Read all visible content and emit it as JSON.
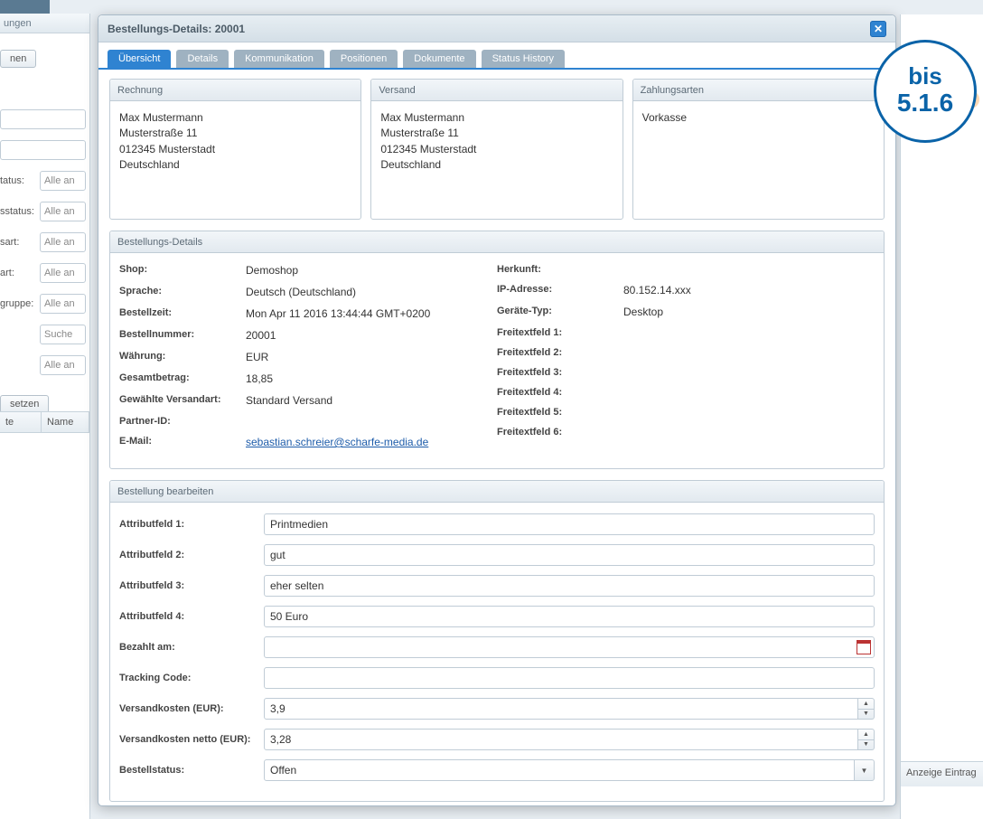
{
  "left": {
    "header": "ungen",
    "btn_nen": "nen",
    "filters": {
      "tatus": {
        "label": "tatus:",
        "value": "Alle an"
      },
      "sstatus": {
        "label": "sstatus:",
        "value": "Alle an"
      },
      "sart": {
        "label": "sart:",
        "value": "Alle an"
      },
      "art": {
        "label": "art:",
        "value": "Alle an"
      },
      "gruppe": {
        "label": "gruppe:",
        "value": "Alle an"
      },
      "suche": {
        "label": "",
        "value": "Suche"
      },
      "alle": {
        "label": "",
        "value": "Alle an"
      }
    },
    "btn_setzen": "setzen",
    "grid_h1": "te",
    "grid_h2": "Name"
  },
  "dialog": {
    "title": "Bestellungs-Details: 20001",
    "tabs": [
      "Übersicht",
      "Details",
      "Kommunikation",
      "Positionen",
      "Dokumente",
      "Status History"
    ],
    "panels": {
      "rechnung": {
        "h": "Rechnung",
        "name": "Max Mustermann",
        "street": "Musterstraße 11",
        "city": "012345 Musterstadt",
        "country": "Deutschland"
      },
      "versand": {
        "h": "Versand",
        "name": "Max Mustermann",
        "street": "Musterstraße 11",
        "city": "012345 Musterstadt",
        "country": "Deutschland"
      },
      "zahlung": {
        "h": "Zahlungsarten",
        "val": "Vorkasse"
      }
    },
    "details": {
      "h": "Bestellungs-Details",
      "left": {
        "shop": {
          "k": "Shop:",
          "v": "Demoshop"
        },
        "sprache": {
          "k": "Sprache:",
          "v": "Deutsch (Deutschland)"
        },
        "bestellzeit": {
          "k": "Bestellzeit:",
          "v": "Mon Apr 11 2016 13:44:44 GMT+0200"
        },
        "bestellnr": {
          "k": "Bestellnummer:",
          "v": "20001"
        },
        "waehrung": {
          "k": "Währung:",
          "v": "EUR"
        },
        "betrag": {
          "k": "Gesamtbetrag:",
          "v": "18,85"
        },
        "versandart": {
          "k": "Gewählte Versandart:",
          "v": "Standard Versand"
        },
        "partner": {
          "k": "Partner-ID:",
          "v": ""
        },
        "email": {
          "k": "E-Mail:",
          "v": "sebastian.schreier@scharfe-media.de"
        }
      },
      "right": {
        "herkunft": {
          "k": "Herkunft:",
          "v": ""
        },
        "ip": {
          "k": "IP-Adresse:",
          "v": "80.152.14.xxx"
        },
        "geraet": {
          "k": "Geräte-Typ:",
          "v": "Desktop"
        },
        "f1": {
          "k": "Freitextfeld 1:",
          "v": ""
        },
        "f2": {
          "k": "Freitextfeld 2:",
          "v": ""
        },
        "f3": {
          "k": "Freitextfeld 3:",
          "v": ""
        },
        "f4": {
          "k": "Freitextfeld 4:",
          "v": ""
        },
        "f5": {
          "k": "Freitextfeld 5:",
          "v": ""
        },
        "f6": {
          "k": "Freitextfeld 6:",
          "v": ""
        }
      }
    },
    "edit": {
      "h": "Bestellung bearbeiten",
      "attr1": {
        "k": "Attributfeld 1:",
        "v": "Printmedien"
      },
      "attr2": {
        "k": "Attributfeld 2:",
        "v": "gut"
      },
      "attr3": {
        "k": "Attributfeld 3:",
        "v": "eher selten"
      },
      "attr4": {
        "k": "Attributfeld 4:",
        "v": "50 Euro"
      },
      "bezahlt": {
        "k": "Bezahlt am:",
        "v": ""
      },
      "tracking": {
        "k": "Tracking Code:",
        "v": ""
      },
      "vk": {
        "k": "Versandkosten (EUR):",
        "v": "3,9"
      },
      "vkn": {
        "k": "Versandkosten netto (EUR):",
        "v": "3,28"
      },
      "status": {
        "k": "Bestellstatus:",
        "v": "Offen"
      }
    }
  },
  "badge": {
    "l1": "bis",
    "l2": "5.1.6"
  },
  "right": {
    "footer": "Anzeige Eintrag"
  }
}
